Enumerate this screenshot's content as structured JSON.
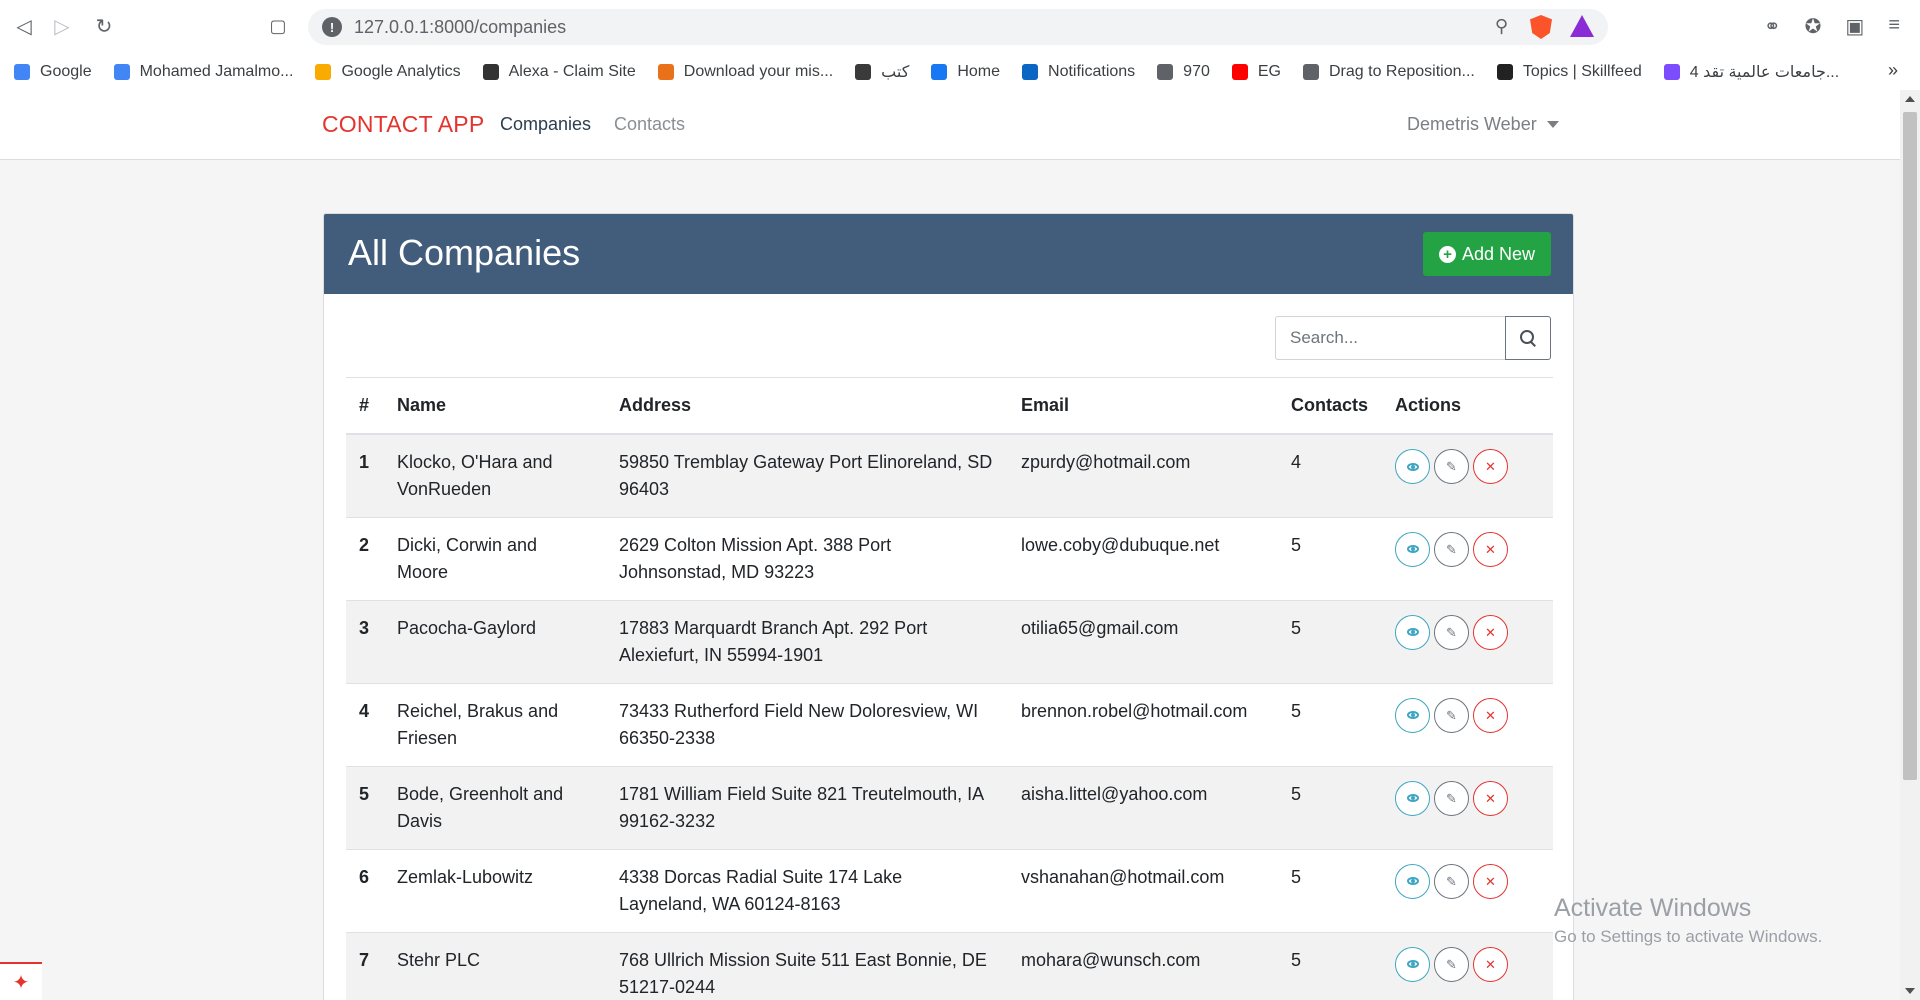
{
  "browser": {
    "url": "127.0.0.1:8000/companies",
    "bookmarks": [
      {
        "label": "Google",
        "icon": "google-icon",
        "color": "#4285f4"
      },
      {
        "label": "Mohamed Jamalmo...",
        "icon": "google-icon",
        "color": "#4285f4"
      },
      {
        "label": "Google Analytics",
        "icon": "analytics-icon",
        "color": "#f9ab00"
      },
      {
        "label": "Alexa - Claim Site",
        "icon": "alexa-icon",
        "color": "#333333"
      },
      {
        "label": "Download your mis...",
        "icon": "gear-icon",
        "color": "#e8711a"
      },
      {
        "label": "كتب",
        "icon": "book-icon",
        "color": "#3a3a3a"
      },
      {
        "label": "Home",
        "icon": "facebook-icon",
        "color": "#1877f2"
      },
      {
        "label": "Notifications",
        "icon": "linkedin-icon",
        "color": "#0a66c2"
      },
      {
        "label": "970",
        "icon": "globe-icon",
        "color": "#5f6368"
      },
      {
        "label": "EG",
        "icon": "youtube-icon",
        "color": "#ff0000"
      },
      {
        "label": "Drag to Reposition...",
        "icon": "globe-icon",
        "color": "#5f6368"
      },
      {
        "label": "Topics | Skillfeed",
        "icon": "skillfeed-icon",
        "color": "#222222"
      },
      {
        "label": "4 جامعات عالمية تقد...",
        "icon": "site-icon",
        "color": "#7c4dff"
      }
    ]
  },
  "navbar": {
    "brand": "CONTACT APP",
    "links": [
      "Companies",
      "Contacts"
    ],
    "user": "Demetris Weber"
  },
  "card": {
    "title": "All Companies",
    "add_label": "Add New"
  },
  "search": {
    "placeholder": "Search..."
  },
  "table": {
    "headers": [
      "#",
      "Name",
      "Address",
      "Email",
      "Contacts",
      "Actions"
    ],
    "rows": [
      {
        "num": "1",
        "name": "Klocko, O'Hara and VonRueden",
        "address": "59850 Tremblay Gateway Port Elinoreland, SD 96403",
        "email": "zpurdy@hotmail.com",
        "contacts": "4"
      },
      {
        "num": "2",
        "name": "Dicki, Corwin and Moore",
        "address": "2629 Colton Mission Apt. 388 Port Johnsonstad, MD 93223",
        "email": "lowe.coby@dubuque.net",
        "contacts": "5"
      },
      {
        "num": "3",
        "name": "Pacocha-Gaylord",
        "address": "17883 Marquardt Branch Apt. 292 Port Alexiefurt, IN 55994-1901",
        "email": "otilia65@gmail.com",
        "contacts": "5"
      },
      {
        "num": "4",
        "name": "Reichel, Brakus and Friesen",
        "address": "73433 Rutherford Field New Doloresview, WI 66350-2338",
        "email": "brennon.robel@hotmail.com",
        "contacts": "5"
      },
      {
        "num": "5",
        "name": "Bode, Greenholt and Davis",
        "address": "1781 William Field Suite 821 Treutelmouth, IA 99162-3232",
        "email": "aisha.littel@yahoo.com",
        "contacts": "5"
      },
      {
        "num": "6",
        "name": "Zemlak-Lubowitz",
        "address": "4338 Dorcas Radial Suite 174 Lake Layneland, WA 60124-8163",
        "email": "vshanahan@hotmail.com",
        "contacts": "5"
      },
      {
        "num": "7",
        "name": "Stehr PLC",
        "address": "768 Ullrich Mission Suite 511 East Bonnie, DE 51217-0244",
        "email": "mohara@wunsch.com",
        "contacts": "5"
      }
    ]
  },
  "watermark": {
    "title": "Activate Windows",
    "subtitle": "Go to Settings to activate Windows."
  },
  "colors": {
    "brand": "#e3342f",
    "header_bg": "#425d7b",
    "add_button": "#23a344",
    "view": "#3ea6c2",
    "edit": "#6c757d",
    "delete": "#e3342f"
  }
}
